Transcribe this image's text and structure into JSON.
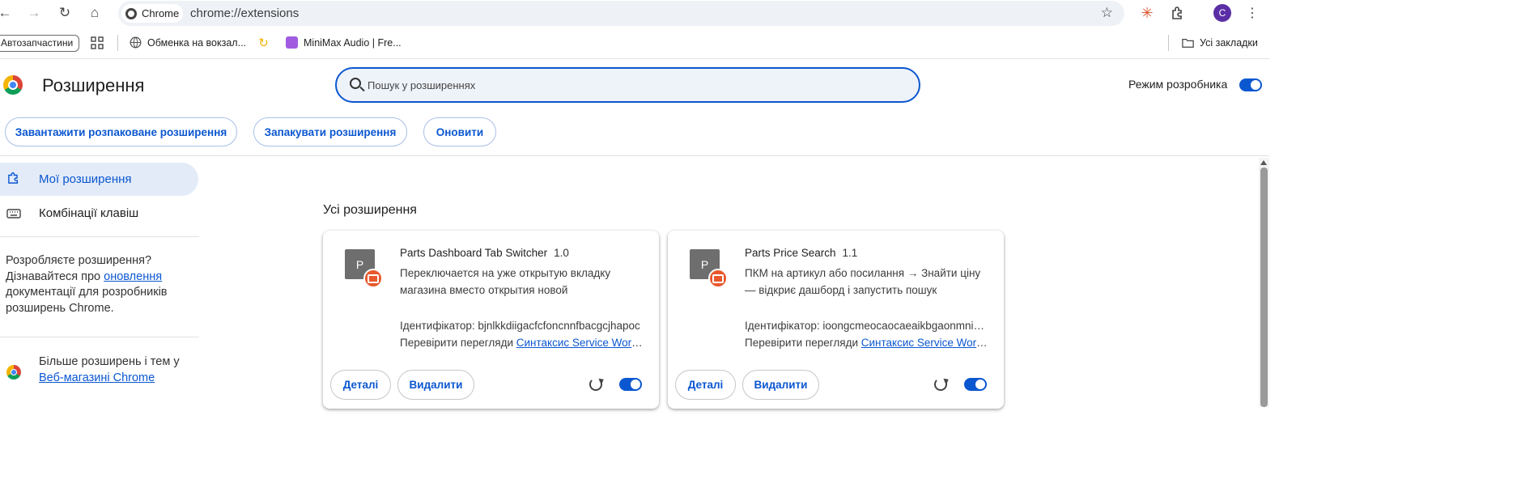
{
  "toolbar": {
    "chip_label": "Chrome",
    "url": "chrome://extensions",
    "avatar_letter": "C"
  },
  "bookmarks": {
    "folder_pill": "Автозапчастини",
    "items": [
      {
        "label": "Обменка на вокзал..."
      },
      {
        "label": "MiniMax Audio | Fre..."
      }
    ],
    "all_bookmarks": "Усі закладки"
  },
  "header": {
    "title": "Розширення",
    "search_placeholder": "Пошук у розширеннях",
    "dev_mode_label": "Режим розробника",
    "dev_mode_on": true
  },
  "actions": {
    "load_unpacked": "Завантажити розпаковане розширення",
    "pack": "Запакувати розширення",
    "update": "Оновити"
  },
  "sidebar": {
    "items": [
      {
        "label": "Мої розширення",
        "active": true
      },
      {
        "label": "Комбінації клавіш",
        "active": false
      }
    ],
    "dev_text_1": "Розробляєте розширення? Дізнавайтеся про ",
    "dev_link": "оновлення",
    "dev_text_2": " документації для розробників розширень Chrome.",
    "store_text_1": "Більше розширень і тем у ",
    "store_link": "Веб-магазині Chrome"
  },
  "main": {
    "section_title": "Усі розширення",
    "cards": [
      {
        "icon_letter": "P",
        "name": "Parts Dashboard Tab Switcher",
        "version": "1.0",
        "description": "Переключается на уже открытую вкладку магазина вместо открытия новой",
        "id_line": "Ідентифікатор: bjnlkkdiigacfcfoncnnfbacgcjhapoc",
        "inspect_prefix": "Перевірити перегляди ",
        "inspect_link": "Синтаксис Service Worker",
        "details": "Деталі",
        "remove": "Видалити",
        "enabled": true
      },
      {
        "icon_letter": "P",
        "name": "Parts Price Search",
        "version": "1.1",
        "description": "ПКМ на артикул або посилання → Знайти ціну — відкриє дашборд і запустить пошук",
        "id_line": "Ідентифікатор: ioongcmeocaocaeaikbgaonmniahcl",
        "inspect_prefix": "Перевірити перегляди ",
        "inspect_link": "Синтаксис Service Worker",
        "details": "Деталі",
        "remove": "Видалити",
        "enabled": true
      }
    ]
  },
  "colors": {
    "accent": "#0b57d0",
    "badge": "#e8582c"
  }
}
